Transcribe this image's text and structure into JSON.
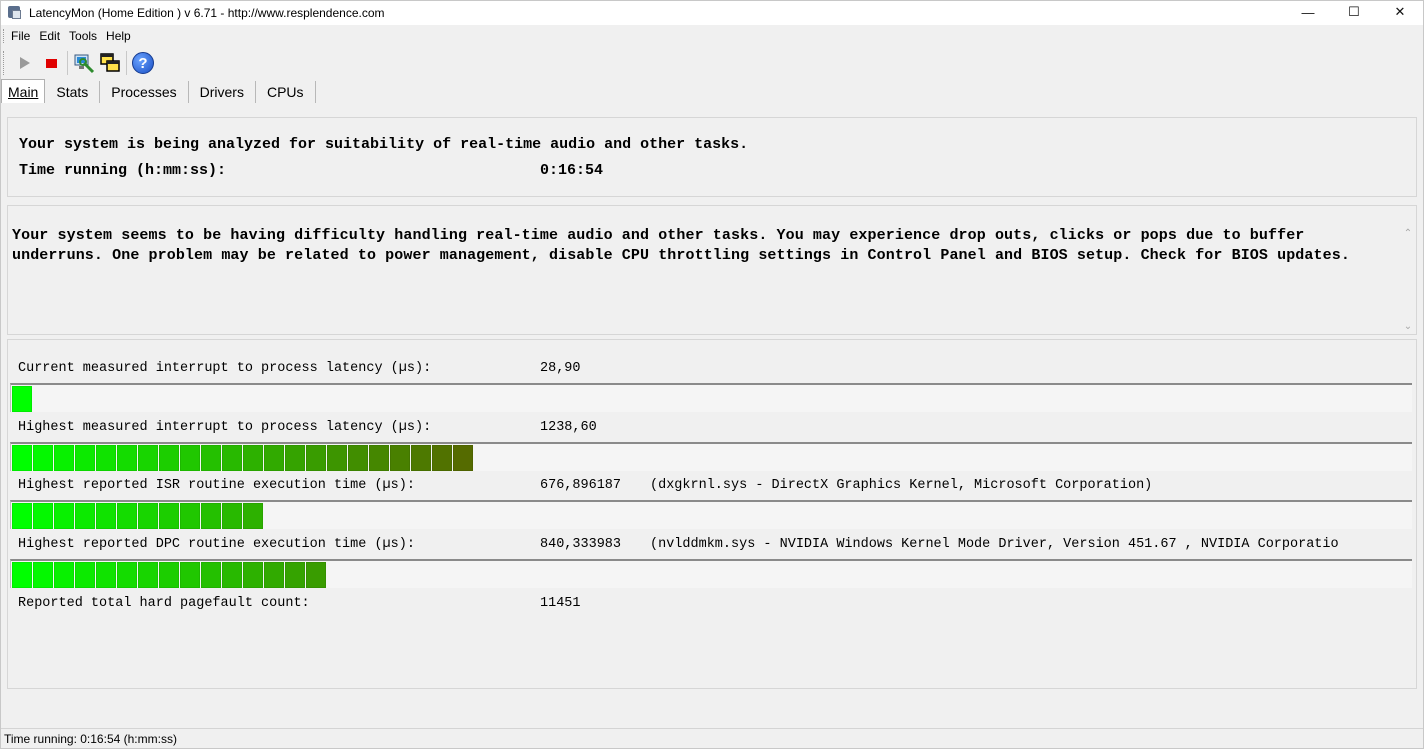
{
  "window": {
    "title": "LatencyMon  (Home Edition )  v 6.71 - http://www.resplendence.com",
    "minimize": "—",
    "maximize": "☐",
    "close": "✕"
  },
  "menu": {
    "file": "File",
    "edit": "Edit",
    "tools": "Tools",
    "help": "Help"
  },
  "toolbar": {
    "icons": [
      "play-icon",
      "stop-icon",
      "analyze-icon",
      "windows-icon",
      "help-icon"
    ],
    "help_glyph": "?"
  },
  "tabs": [
    "Main",
    "Stats",
    "Processes",
    "Drivers",
    "CPUs"
  ],
  "active_tab": "Main",
  "status_panel": {
    "line1": "Your system is being analyzed for suitability of real-time audio and other tasks.",
    "time_label": "Time running (h:mm:ss):",
    "time_value": "0:16:54"
  },
  "conclusion": {
    "text": "Your system seems to be having difficulty handling real-time audio and other tasks. You may experience drop outs, clicks or pops due to buffer underruns. One problem may be related to power management, disable CPU throttling settings in Control Panel and BIOS setup. Check for BIOS updates.",
    "scroll_up": "⌃",
    "scroll_down": "⌄"
  },
  "metrics": [
    {
      "label": "Current measured interrupt to process latency (µs):",
      "value": "28,90",
      "extra": "",
      "bar_segments": 1
    },
    {
      "label": "Highest measured interrupt to process latency (µs):",
      "value": "1238,60",
      "extra": "",
      "bar_segments": 22
    },
    {
      "label": "Highest reported ISR routine execution time (µs):",
      "value": "676,896187",
      "extra": "(dxgkrnl.sys - DirectX Graphics Kernel, Microsoft Corporation)",
      "bar_segments": 12
    },
    {
      "label": "Highest reported DPC routine execution time (µs):",
      "value": "840,333983",
      "extra": "(nvlddmkm.sys - NVIDIA Windows Kernel Mode Driver, Version 451.67 , NVIDIA Corporatio",
      "bar_segments": 15
    },
    {
      "label": "Reported total hard pagefault count:",
      "value": "11451",
      "extra": ""
    }
  ],
  "colors": {
    "bar_start": "#00ff00",
    "bar_end": "#556b00",
    "stop": "#e00000"
  },
  "statusbar": {
    "text": "Time running: 0:16:54  (h:mm:ss)"
  }
}
